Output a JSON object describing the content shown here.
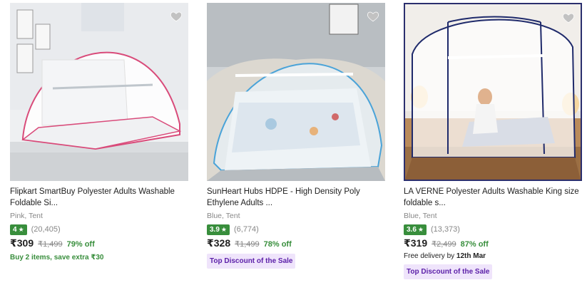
{
  "products": [
    {
      "title": "Flipkart SmartBuy Polyester Adults Washable Foldable Si...",
      "variant": "Pink, Tent",
      "rating": "4",
      "rating_count": "(20,405)",
      "price": "₹309",
      "mrp": "₹1,499",
      "discount": "79% off",
      "offer": "Buy 2 items, save extra ₹30",
      "image_icon": "pink-mosquito-net-tent-image",
      "accent": "#d63b6e"
    },
    {
      "title": "SunHeart Hubs HDPE - High Density Poly Ethylene Adults ...",
      "variant": "Blue, Tent",
      "rating": "3.9",
      "rating_count": "(6,774)",
      "price": "₹328",
      "mrp": "₹1,499",
      "discount": "78% off",
      "tag": "Top Discount of the Sale",
      "image_icon": "blue-mosquito-net-tent-image",
      "accent": "#3b8fd6"
    },
    {
      "title": "LA VERNE Polyester Adults Washable King size foldable s...",
      "variant": "Blue, Tent",
      "rating": "3.6",
      "rating_count": "(13,373)",
      "price": "₹319",
      "mrp": "₹2,499",
      "discount": "87% off",
      "delivery_prefix": "Free delivery by ",
      "delivery_date": "12th Mar",
      "tag": "Top Discount of the Sale",
      "image_icon": "navy-mosquito-net-tent-image",
      "accent": "#1f2a6b"
    }
  ],
  "colors": {
    "rating_green": "#388e3c",
    "discount_green": "#388e3c",
    "tag_bg": "#efe4fb",
    "tag_text": "#5b1fa8"
  }
}
